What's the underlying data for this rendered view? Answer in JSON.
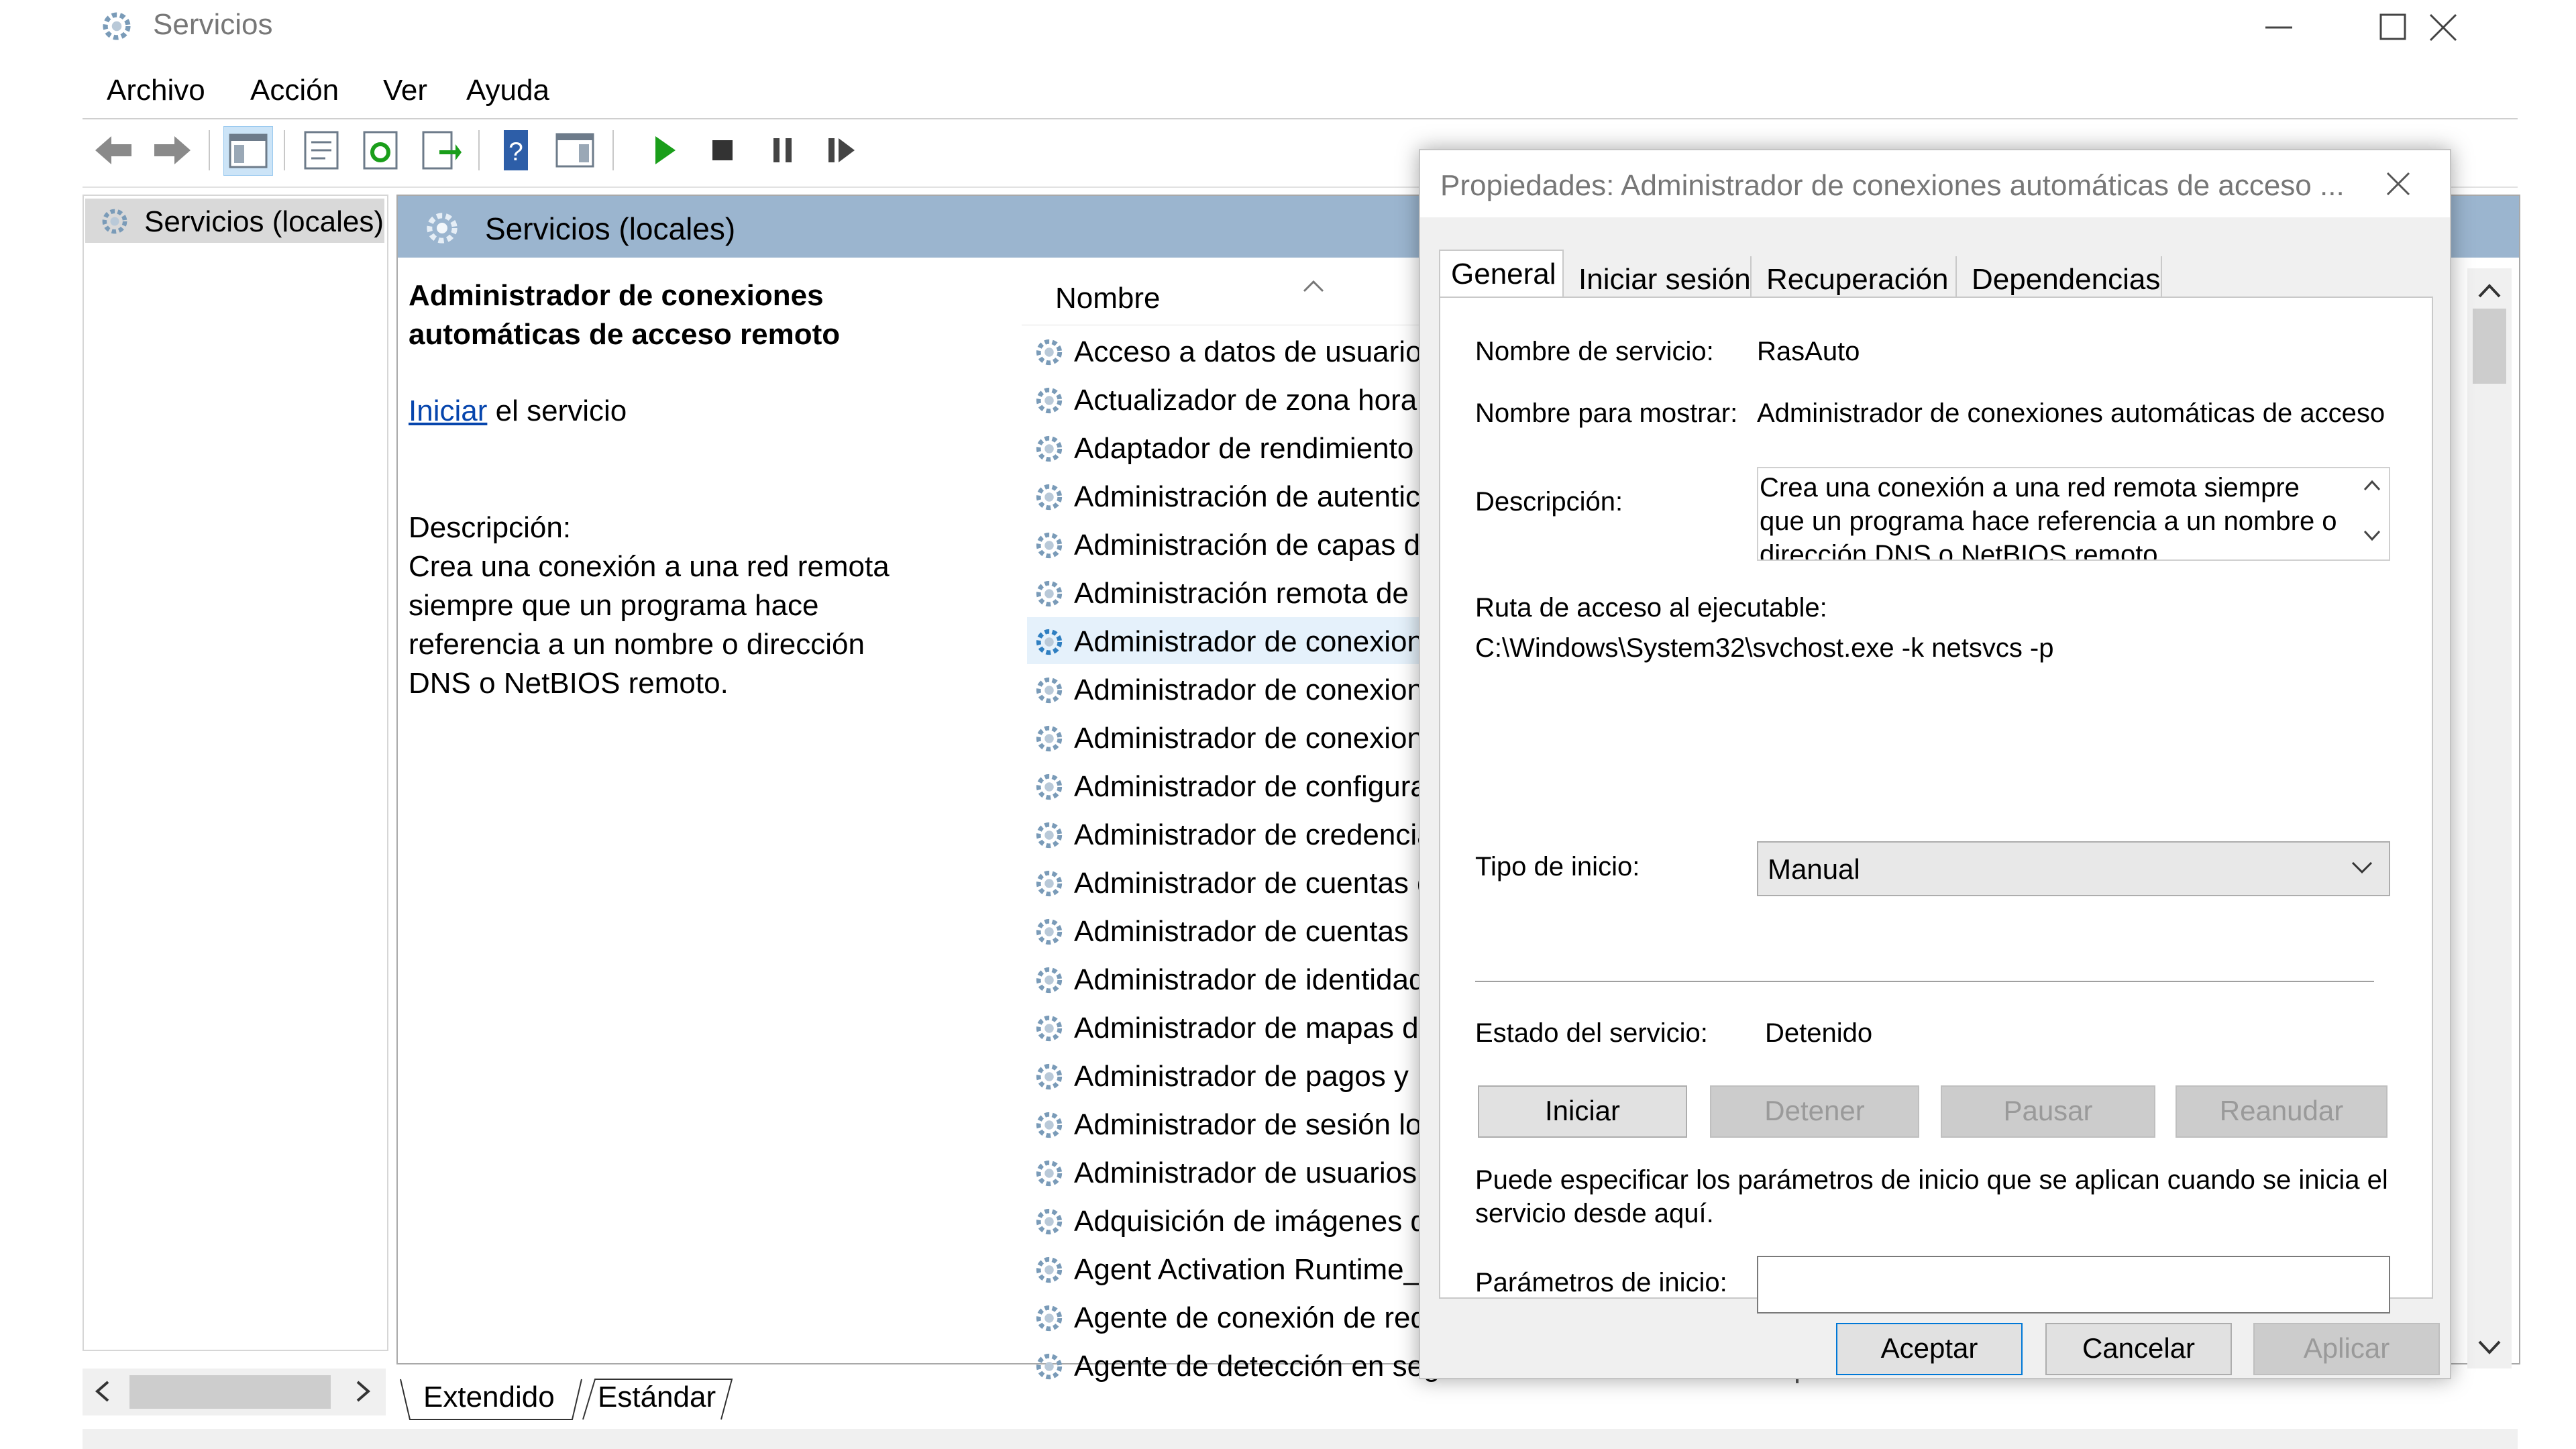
{
  "window": {
    "title": "Servicios",
    "menu": [
      "Archivo",
      "Acción",
      "Ver",
      "Ayuda"
    ]
  },
  "tree": {
    "root_label": "Servicios (locales)"
  },
  "main": {
    "header_title": "Servicios (locales)",
    "selected_service_title": "Administrador de conexiones automáticas de acceso remoto",
    "start_link": "Iniciar",
    "start_suffix": " el servicio",
    "description_label": "Descripción:",
    "description_text": "Crea una conexión a una red remota siempre que un programa hace referencia a un nombre o dirección DNS o NetBIOS remoto.",
    "column_name": "Nombre",
    "services": [
      "Acceso a datos de usuarios_...",
      "Actualizador de zona horari...",
      "Adaptador de rendimiento ...",
      "Administración de autentic...",
      "Administración de capas de...",
      "Administración remota de ...",
      "Administrador de conexion...",
      "Administrador de conexion...",
      "Administrador de conexion...",
      "Administrador de configura...",
      "Administrador de credencia...",
      "Administrador de cuentas d...",
      "Administrador de cuentas ...",
      "Administrador de identidad...",
      "Administrador de mapas de...",
      "Administrador de pagos y ...",
      "Administrador de sesión local",
      "Administrador de usuarios",
      "Adquisición de imágenes d...",
      "Agent Activation Runtime_...",
      "Agente de conexión de red",
      "Agente de detección en seg..."
    ],
    "selected_index": 6,
    "tabs": [
      "Extendido",
      "Estándar"
    ]
  },
  "dialog": {
    "title": "Propiedades: Administrador de conexiones automáticas de acceso ...",
    "tabs": [
      "General",
      "Iniciar sesión",
      "Recuperación",
      "Dependencias"
    ],
    "active_tab": "General",
    "service_name_label": "Nombre de servicio:",
    "service_name_value": "RasAuto",
    "display_name_label": "Nombre para mostrar:",
    "display_name_value": "Administrador de conexiones automáticas de acceso",
    "description_label": "Descripción:",
    "description_value": "Crea una conexión a una red remota siempre que un programa hace referencia a un nombre o dirección DNS o NetBIOS remoto.",
    "exe_path_label": "Ruta de acceso al ejecutable:",
    "exe_path_value": "C:\\Windows\\System32\\svchost.exe -k netsvcs -p",
    "startup_type_label": "Tipo de inicio:",
    "startup_type_value": "Manual",
    "status_label": "Estado del servicio:",
    "status_value": "Detenido",
    "buttons": {
      "start": "Iniciar",
      "stop": "Detener",
      "pause": "Pausar",
      "resume": "Reanudar"
    },
    "hint": "Puede especificar los parámetros de inicio que se aplican cuando se inicia el servicio desde aquí.",
    "params_label": "Parámetros de inicio:",
    "params_value": "",
    "footer": {
      "ok": "Aceptar",
      "cancel": "Cancelar",
      "apply": "Aplicar"
    }
  },
  "colors": {
    "header_blue": "#9bb5cf",
    "selection": "#e5f1fb",
    "link": "#0645ad",
    "play_green": "#1a9e1a"
  }
}
